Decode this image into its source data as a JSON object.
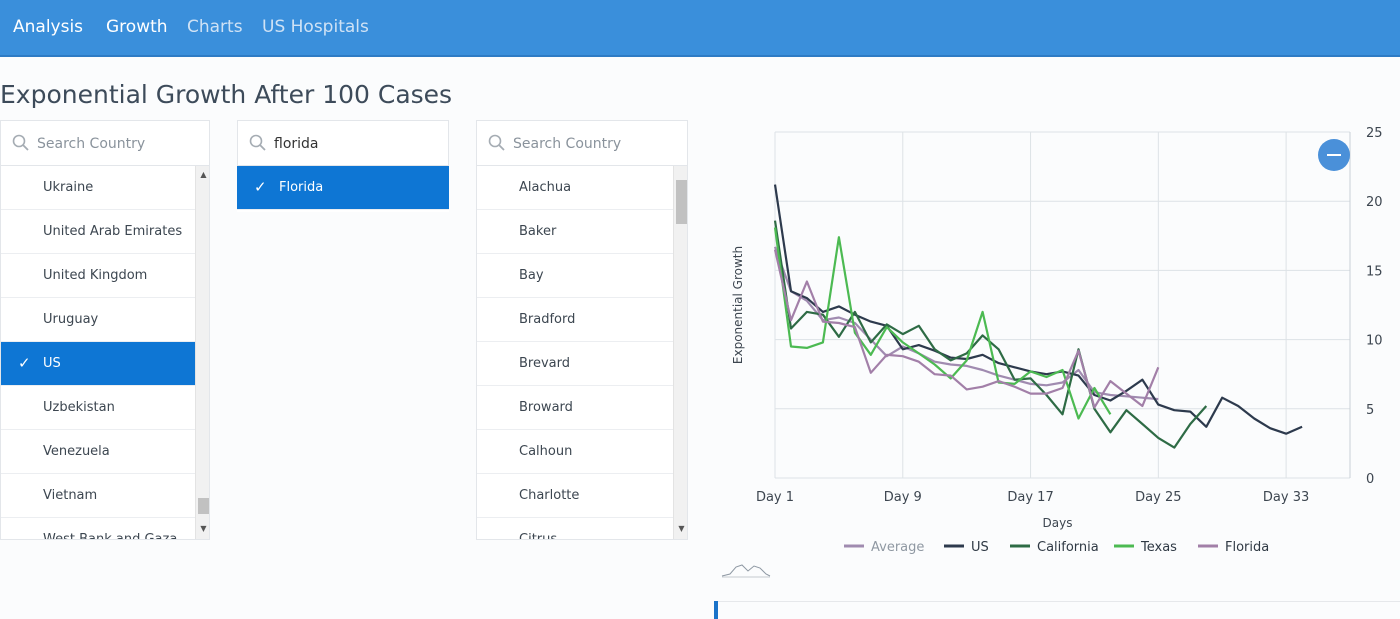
{
  "nav": {
    "items": [
      {
        "label": "Analysis",
        "active": true
      },
      {
        "label": "Growth",
        "active": true
      },
      {
        "label": "Charts",
        "active": false
      },
      {
        "label": "US Hospitals",
        "active": false
      }
    ]
  },
  "page_title": "Exponential Growth After 100 Cases",
  "country_panel": {
    "search_placeholder": "Search Country",
    "search_value": "",
    "items": [
      "Ukraine",
      "United Arab Emirates",
      "United Kingdom",
      "Uruguay",
      "US",
      "Uzbekistan",
      "Venezuela",
      "Vietnam",
      "West Bank and Gaza"
    ],
    "selected": "US"
  },
  "state_panel": {
    "search_placeholder": "",
    "search_value": "florida",
    "items": [
      "Florida"
    ],
    "selected": "Florida"
  },
  "county_panel": {
    "search_placeholder": "Search Country",
    "search_value": "",
    "items": [
      "Alachua",
      "Baker",
      "Bay",
      "Bradford",
      "Brevard",
      "Broward",
      "Calhoun",
      "Charlotte",
      "Citrus"
    ]
  },
  "check_glyph": "✓",
  "chart_data": {
    "type": "line",
    "xlabel": "Days",
    "ylabel": "Exponential Growth",
    "ylim": [
      0,
      25
    ],
    "yticks": [
      0,
      5,
      10,
      15,
      20,
      25
    ],
    "xlim": [
      1,
      37
    ],
    "xticks": [
      {
        "day": 1,
        "label": "Day 1"
      },
      {
        "day": 9,
        "label": "Day 9"
      },
      {
        "day": 17,
        "label": "Day 17"
      },
      {
        "day": 25,
        "label": "Day 25"
      },
      {
        "day": 33,
        "label": "Day 33"
      }
    ],
    "grid": true,
    "legend_position": "bottom",
    "series": [
      {
        "name": "Average",
        "color": "#a08bb0",
        "x": [
          1,
          2,
          3,
          4,
          5,
          6,
          7,
          8,
          9,
          10,
          11,
          12,
          13,
          14,
          15,
          16,
          17,
          18,
          19,
          20,
          21,
          22,
          23,
          24,
          25
        ],
        "y": [
          16.7,
          13.5,
          12.8,
          11.4,
          11.6,
          11.2,
          10.0,
          8.8,
          9.5,
          9.0,
          8.4,
          8.2,
          8.1,
          7.8,
          7.4,
          7.1,
          6.8,
          6.7,
          6.9,
          7.8,
          6.2,
          6.0,
          5.9,
          5.8,
          5.7
        ]
      },
      {
        "name": "US",
        "color": "#2d3a4d",
        "x": [
          1,
          2,
          3,
          4,
          5,
          6,
          7,
          8,
          9,
          10,
          11,
          12,
          13,
          14,
          15,
          16,
          17,
          18,
          19,
          20,
          21,
          22,
          23,
          24,
          25,
          26,
          27,
          28,
          29,
          30,
          31,
          32,
          33,
          34
        ],
        "y": [
          21.2,
          13.5,
          13.0,
          12.0,
          12.4,
          11.8,
          11.3,
          11.0,
          9.3,
          9.6,
          9.2,
          8.7,
          8.6,
          8.9,
          8.3,
          8.0,
          7.7,
          7.5,
          7.7,
          7.4,
          6.0,
          5.6,
          6.3,
          7.1,
          5.3,
          4.9,
          4.8,
          3.7,
          5.8,
          5.2,
          4.3,
          3.6,
          3.2,
          3.7
        ]
      },
      {
        "name": "California",
        "color": "#2e6b45",
        "x": [
          1,
          2,
          3,
          4,
          5,
          6,
          7,
          8,
          9,
          10,
          11,
          12,
          13,
          14,
          15,
          16,
          17,
          18,
          19,
          20,
          21,
          22,
          23,
          24,
          25,
          26,
          27,
          28
        ],
        "y": [
          18.6,
          10.8,
          12.0,
          11.8,
          10.2,
          12.0,
          9.8,
          11.1,
          10.4,
          11.0,
          9.3,
          8.5,
          9.0,
          10.3,
          9.3,
          7.1,
          7.2,
          6.0,
          4.6,
          9.3,
          5.0,
          3.3,
          4.9,
          3.9,
          2.9,
          2.2,
          3.9,
          5.2
        ]
      },
      {
        "name": "Texas",
        "color": "#4cba52",
        "x": [
          1,
          2,
          3,
          4,
          5,
          6,
          7,
          8,
          9,
          10,
          11,
          12,
          13,
          14,
          15,
          16,
          17,
          18,
          19,
          20,
          21,
          22
        ],
        "y": [
          18.1,
          9.5,
          9.4,
          9.8,
          17.4,
          10.5,
          8.9,
          10.9,
          9.8,
          9.0,
          8.2,
          7.2,
          8.5,
          12.0,
          6.9,
          6.8,
          7.7,
          7.3,
          7.8,
          4.3,
          6.5,
          4.6
        ]
      },
      {
        "name": "Florida",
        "color": "#a27fa8",
        "x": [
          1,
          2,
          3,
          4,
          5,
          6,
          7,
          8,
          9,
          10,
          11,
          12,
          13,
          14,
          15,
          16,
          17,
          18,
          19,
          20,
          21,
          22,
          23,
          24,
          25
        ],
        "y": [
          16.5,
          11.4,
          14.2,
          11.3,
          11.2,
          10.9,
          7.6,
          8.9,
          8.8,
          8.4,
          7.5,
          7.4,
          6.4,
          6.6,
          7.0,
          6.6,
          6.1,
          6.1,
          6.5,
          9.2,
          5.1,
          7.0,
          6.1,
          5.2,
          8.0
        ]
      }
    ]
  }
}
